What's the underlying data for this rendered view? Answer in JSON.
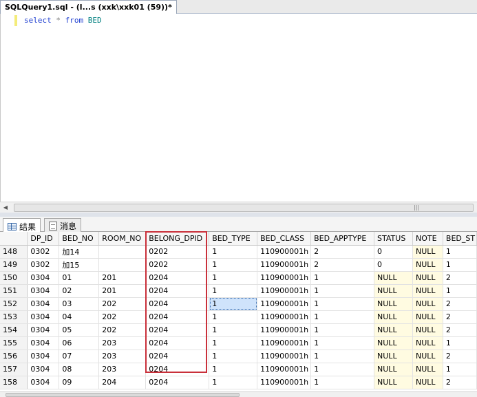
{
  "tab": {
    "title": "SQLQuery1.sql - (l...s (xxk\\xxk01 (59))*"
  },
  "editor": {
    "kw_select": "select",
    "star": "*",
    "kw_from": "from",
    "table": "BED"
  },
  "results": {
    "tabs": [
      {
        "label": "结果",
        "icon": "grid-icon"
      },
      {
        "label": "消息",
        "icon": "message-icon"
      }
    ],
    "columns": [
      "DP_ID",
      "BED_NO",
      "ROOM_NO",
      "BELONG_DPID",
      "BED_TYPE",
      "BED_CLASS",
      "BED_APPTYPE",
      "STATUS",
      "NOTE",
      "BED_ST"
    ],
    "rows": [
      {
        "n": "148",
        "c": [
          "0302",
          "加14",
          "",
          "0202",
          "1",
          "110900001h",
          "2",
          "0",
          "NULL",
          "1"
        ]
      },
      {
        "n": "149",
        "c": [
          "0302",
          "加15",
          "",
          "0202",
          "1",
          "110900001h",
          "2",
          "0",
          "NULL",
          "1"
        ]
      },
      {
        "n": "150",
        "c": [
          "0304",
          "01",
          "201",
          "0204",
          "1",
          "110900001h",
          "1",
          "NULL",
          "NULL",
          "2"
        ]
      },
      {
        "n": "151",
        "c": [
          "0304",
          "02",
          "201",
          "0204",
          "1",
          "110900001h",
          "1",
          "NULL",
          "NULL",
          "1"
        ]
      },
      {
        "n": "152",
        "c": [
          "0304",
          "03",
          "202",
          "0204",
          "1",
          "110900001h",
          "1",
          "NULL",
          "NULL",
          "2"
        ]
      },
      {
        "n": "153",
        "c": [
          "0304",
          "04",
          "202",
          "0204",
          "1",
          "110900001h",
          "1",
          "NULL",
          "NULL",
          "2"
        ]
      },
      {
        "n": "154",
        "c": [
          "0304",
          "05",
          "202",
          "0204",
          "1",
          "110900001h",
          "1",
          "NULL",
          "NULL",
          "2"
        ]
      },
      {
        "n": "155",
        "c": [
          "0304",
          "06",
          "203",
          "0204",
          "1",
          "110900001h",
          "1",
          "NULL",
          "NULL",
          "1"
        ]
      },
      {
        "n": "156",
        "c": [
          "0304",
          "07",
          "203",
          "0204",
          "1",
          "110900001h",
          "1",
          "NULL",
          "NULL",
          "2"
        ]
      },
      {
        "n": "157",
        "c": [
          "0304",
          "08",
          "203",
          "0204",
          "1",
          "110900001h",
          "1",
          "NULL",
          "NULL",
          "1"
        ]
      },
      {
        "n": "158",
        "c": [
          "0304",
          "09",
          "204",
          "0204",
          "1",
          "110900001h",
          "1",
          "NULL",
          "NULL",
          "2"
        ]
      }
    ]
  },
  "colors": {
    "highlight": "#c9303a",
    "null_cell": "#fffbe1",
    "selected_cell": "#cfe3fb",
    "keyword": "#1f3fd1",
    "identifier": "#008080"
  }
}
